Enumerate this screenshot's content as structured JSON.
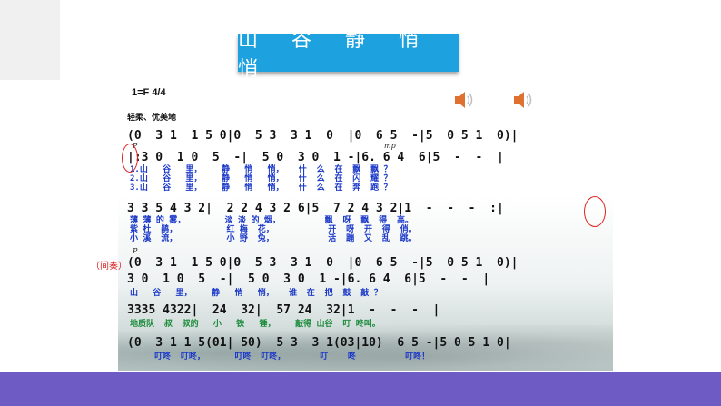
{
  "title": "山 谷 静 悄 悄",
  "key_signature": "1=F 4/4",
  "tempo_marking": "轻柔、优美地",
  "interlude_label": "（间奏）",
  "dynamics": {
    "p": "P",
    "mp": "mp"
  },
  "icons": [
    "speaker-icon",
    "speaker-icon"
  ],
  "colors": {
    "banner": "#1ea2df",
    "bottom_band": "#6e5bc4",
    "lyrics_blue": "#1a38c8",
    "lyrics_green": "#1a8a3a",
    "circle_red": "#e02020"
  },
  "score": {
    "line1": "(0  3 1  1 5 0|0  5 3  3 1  0  |0  6 5  -|5  0 5 1  0)|",
    "line2": "|:3 0  1 0  5  -|  5 0  3 0  1 -|6. 6 4  6|5  -  -  |",
    "lyrics2": [
      "1.山   谷   里，    静   悄   悄，   什  么  在  飘  飘 ？",
      "2.山   谷   里，    静   悄   悄，   什  么  在  闪  耀 ？",
      "3.山   谷   里，    静   悄   悄，   什  么  在  奔  跑 ？"
    ],
    "line3": "3 3 5 4 3 2|  2 2 4 3 2 6|5  7 2 4 3 2|1  -  -  -  :|",
    "lyrics3": [
      "薄 薄 的 雾，        淡 淡 的 烟，         飘  呀  飘  得  高。",
      "紫 杜  鹃，          红 梅  花，           开  呀  开  得  俏。",
      "小 溪  流，          小 野  兔，           活  蹦  又  乱  跳。"
    ],
    "line4": "(0  3 1  1 5 0|0  5 3  3 1  0  |0  6 5  -|5  0 5 1  0)|",
    "line5": "3 0  1 0  5  -|  5 0  3 0  1 -|6. 6 4  6|5  -  -  |",
    "lyrics5": "山   谷   里，    静   悄   悄，   谁  在  把  鼓  敲 ？",
    "line6": "3335 4322|  24  32|  57 24  32|1  -  -  -  |",
    "lyrics6": "地质队  叔  叔的   小   铁   锤，    敲得 山谷  叮 咚叫。",
    "line7": "(0  3 1 1 5(01| 50)  5 3  3 1(03|10)  6 5 -|5 0 5 1 0|",
    "lyrics7": "     叮咚  叮咚，      叮咚  叮咚，       叮    咚          叮咚！"
  }
}
